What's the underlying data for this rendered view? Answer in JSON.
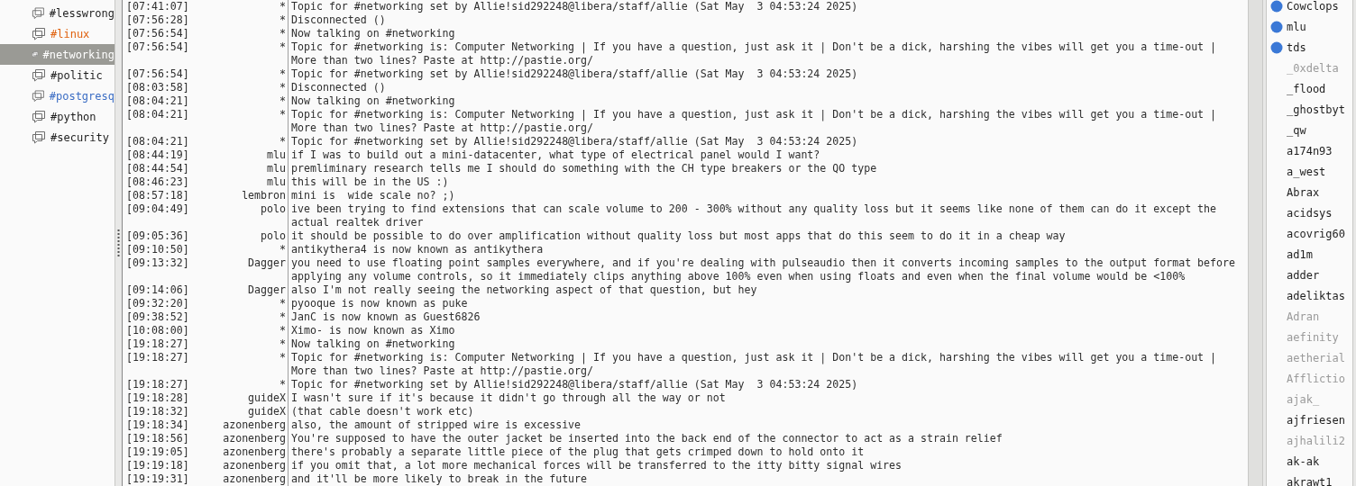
{
  "channels": [
    {
      "name": "#lesswrong",
      "color": "#1e1e1e",
      "selected": false
    },
    {
      "name": "#linux",
      "color": "#e0620f",
      "selected": false
    },
    {
      "name": "#networking",
      "selected": true
    },
    {
      "name": "#politic",
      "color": "#1e1e1e",
      "selected": false
    },
    {
      "name": "#postgresq",
      "color": "#3b6dc4",
      "selected": false
    },
    {
      "name": "#python",
      "color": "#1e1e1e",
      "selected": false
    },
    {
      "name": "#security",
      "color": "#1e1e1e",
      "selected": false
    }
  ],
  "messages": [
    {
      "time": "[07:41:07]",
      "nick": "*",
      "text": "Topic for #networking set by Allie!sid292248@libera/staff/allie (Sat May  3 04:53:24 2025)"
    },
    {
      "time": "[07:56:28]",
      "nick": "*",
      "text": "Disconnected ()"
    },
    {
      "time": "[07:56:54]",
      "nick": "*",
      "text": "Now talking on #networking"
    },
    {
      "time": "[07:56:54]",
      "nick": "*",
      "text": "Topic for #networking is: Computer Networking | If you have a question, just ask it | Don't be a dick, harshing the vibes will get you a time-out | More than two lines? Paste at http://pastie.org/"
    },
    {
      "time": "[07:56:54]",
      "nick": "*",
      "text": "Topic for #networking set by Allie!sid292248@libera/staff/allie (Sat May  3 04:53:24 2025)"
    },
    {
      "time": "[08:03:58]",
      "nick": "*",
      "text": "Disconnected ()"
    },
    {
      "time": "[08:04:21]",
      "nick": "*",
      "text": "Now talking on #networking"
    },
    {
      "time": "[08:04:21]",
      "nick": "*",
      "text": "Topic for #networking is: Computer Networking | If you have a question, just ask it | Don't be a dick, harshing the vibes will get you a time-out | More than two lines? Paste at http://pastie.org/"
    },
    {
      "time": "[08:04:21]",
      "nick": "*",
      "text": "Topic for #networking set by Allie!sid292248@libera/staff/allie (Sat May  3 04:53:24 2025)"
    },
    {
      "time": "[08:44:19]",
      "nick": "mlu",
      "text": "if I was to build out a mini-datacenter, what type of electrical panel would I want?"
    },
    {
      "time": "[08:44:54]",
      "nick": "mlu",
      "text": "premliminary research tells me I should do something with the CH type breakers or the QO type"
    },
    {
      "time": "[08:46:23]",
      "nick": "mlu",
      "text": "this will be in the US :)"
    },
    {
      "time": "[08:57:18]",
      "nick": "lembron",
      "text": "mini is  wide scale no? ;)"
    },
    {
      "time": "[09:04:49]",
      "nick": "polo",
      "text": "ive been trying to find extensions that can scale volume to 200 - 300% without any quality loss but it seems like none of them can do it except the actual realtek driver"
    },
    {
      "time": "[09:05:36]",
      "nick": "polo",
      "text": "it should be possible to do over amplification without quality loss but most apps that do this seem to do it in a cheap way"
    },
    {
      "time": "[09:10:50]",
      "nick": "*",
      "text": "antikythera4 is now known as antikythera"
    },
    {
      "time": "[09:13:32]",
      "nick": "Dagger",
      "text": "you need to use floating point samples everywhere, and if you're dealing with pulseaudio then it converts incoming samples to the output format before applying any volume controls, so it immediately clips anything above 100% even when using floats and even when the final volume would be <100%"
    },
    {
      "time": "[09:14:06]",
      "nick": "Dagger",
      "text": "also I'm not really seeing the networking aspect of that question, but hey"
    },
    {
      "time": "[09:32:20]",
      "nick": "*",
      "text": "pyooque is now known as puke"
    },
    {
      "time": "[09:38:52]",
      "nick": "*",
      "text": "JanC is now known as Guest6826"
    },
    {
      "time": "[10:08:00]",
      "nick": "*",
      "text": "Ximo- is now known as Ximo"
    },
    {
      "time": "[19:18:27]",
      "nick": "*",
      "text": "Now talking on #networking"
    },
    {
      "time": "[19:18:27]",
      "nick": "*",
      "text": "Topic for #networking is: Computer Networking | If you have a question, just ask it | Don't be a dick, harshing the vibes will get you a time-out | More than two lines? Paste at http://pastie.org/"
    },
    {
      "time": "[19:18:27]",
      "nick": "*",
      "text": "Topic for #networking set by Allie!sid292248@libera/staff/allie (Sat May  3 04:53:24 2025)"
    },
    {
      "time": "[19:18:28]",
      "nick": "guideX",
      "text": "I wasn't sure if it's because it didn't go through all the way or not"
    },
    {
      "time": "[19:18:32]",
      "nick": "guideX",
      "text": "(that cable doesn't work etc)"
    },
    {
      "time": "[19:18:34]",
      "nick": "azonenberg",
      "text": "also, the amount of stripped wire is excessive"
    },
    {
      "time": "[19:18:56]",
      "nick": "azonenberg",
      "text": "You're supposed to have the outer jacket be inserted into the back end of the connector to act as a strain relief"
    },
    {
      "time": "[19:19:05]",
      "nick": "azonenberg",
      "text": "there's probably a separate little piece of the plug that gets crimped down to hold onto it"
    },
    {
      "time": "[19:19:18]",
      "nick": "azonenberg",
      "text": "if you omit that, a lot more mechanical forces will be transferred to the itty bitty signal wires"
    },
    {
      "time": "[19:19:31]",
      "nick": "azonenberg",
      "text": "and it'll be more likely to break in the future"
    }
  ],
  "users": [
    {
      "name": "Cowclops",
      "op": true,
      "away": false
    },
    {
      "name": "mlu",
      "op": true,
      "away": false
    },
    {
      "name": "tds",
      "op": true,
      "away": false
    },
    {
      "name": "_0xdelta",
      "op": false,
      "away": true
    },
    {
      "name": "_flood",
      "op": false,
      "away": false
    },
    {
      "name": "_ghostbyt",
      "op": false,
      "away": false
    },
    {
      "name": "_qw",
      "op": false,
      "away": false
    },
    {
      "name": "a174n93",
      "op": false,
      "away": false
    },
    {
      "name": "a_west",
      "op": false,
      "away": false
    },
    {
      "name": "Abrax",
      "op": false,
      "away": false
    },
    {
      "name": "acidsys",
      "op": false,
      "away": false
    },
    {
      "name": "acovrig60",
      "op": false,
      "away": false
    },
    {
      "name": "ad1m",
      "op": false,
      "away": false
    },
    {
      "name": "adder",
      "op": false,
      "away": false
    },
    {
      "name": "adeliktas",
      "op": false,
      "away": false
    },
    {
      "name": "Adran",
      "op": false,
      "away": true
    },
    {
      "name": "aefinity",
      "op": false,
      "away": true
    },
    {
      "name": "aetherial",
      "op": false,
      "away": true
    },
    {
      "name": "Afflictio",
      "op": false,
      "away": true
    },
    {
      "name": "ajak_",
      "op": false,
      "away": true
    },
    {
      "name": "ajfriesen",
      "op": false,
      "away": false
    },
    {
      "name": "ajhalili2",
      "op": false,
      "away": true
    },
    {
      "name": "ak-ak",
      "op": false,
      "away": false
    },
    {
      "name": "akrawt1",
      "op": false,
      "away": false
    }
  ]
}
